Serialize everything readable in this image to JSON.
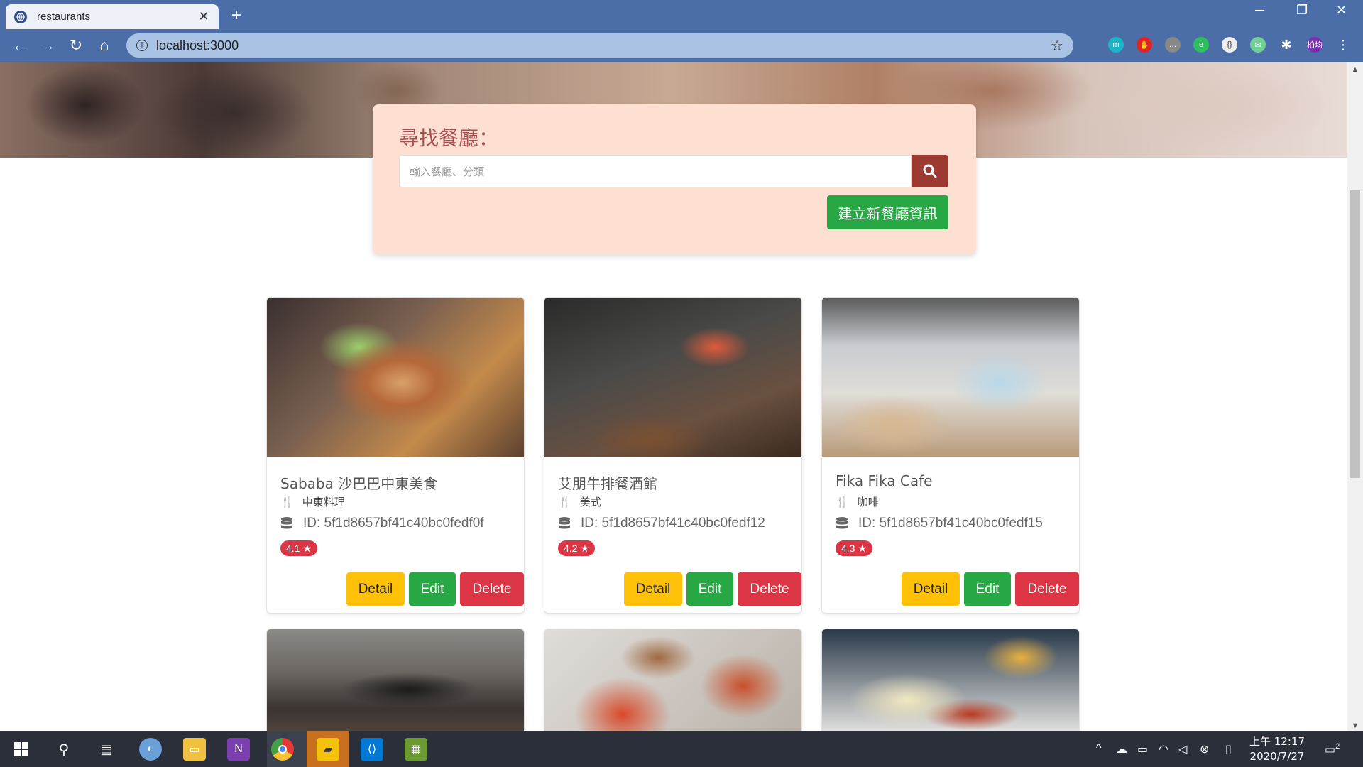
{
  "browser": {
    "tab_title": "restaurants",
    "tab_close": "✕",
    "new_tab": "+",
    "url": "localhost:3000",
    "profile_label": "柏均"
  },
  "search": {
    "heading": "尋找餐廳：",
    "placeholder": "輸入餐廳、分類",
    "create_button": "建立新餐廳資訊"
  },
  "restaurants": [
    {
      "name": "Sababa 沙巴巴中東美食",
      "category": "中東料理",
      "id": "ID: 5f1d8657bf41c40bc0fedf0f",
      "rating": "4.1"
    },
    {
      "name": "艾朋牛排餐酒館",
      "category": "美式",
      "id": "ID: 5f1d8657bf41c40bc0fedf12",
      "rating": "4.2"
    },
    {
      "name": "Fika Fika Cafe",
      "category": "咖啡",
      "id": "ID: 5f1d8657bf41c40bc0fedf15",
      "rating": "4.3"
    }
  ],
  "card_actions": {
    "detail": "Detail",
    "edit": "Edit",
    "delete": "Delete"
  },
  "taskbar": {
    "time": "上午 12:17",
    "date": "2020/7/27",
    "notifications": "2"
  },
  "colors": {
    "chrome_frame": "#4b6ea8",
    "search_panel": "#fde0d2",
    "search_button": "#9c3a32",
    "success": "#28a745",
    "warning": "#ffc107",
    "danger": "#dc3545"
  }
}
